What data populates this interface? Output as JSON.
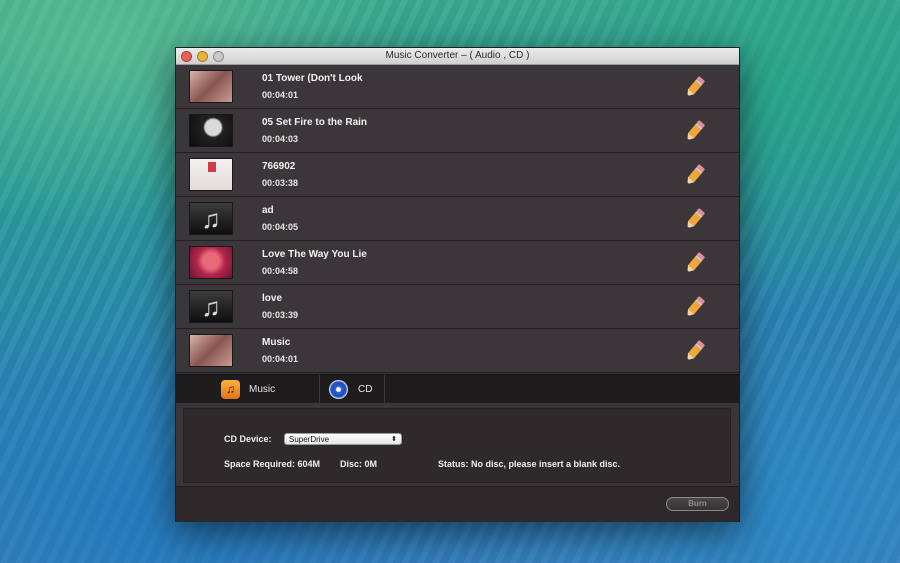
{
  "window": {
    "title": "Music Converter – ( Audio , CD )"
  },
  "tracks": [
    {
      "title": "01 Tower (Don't Look",
      "duration": "00:04:01",
      "art": "album-art"
    },
    {
      "title": "05 Set Fire to the Rain",
      "duration": "00:04:03",
      "art": "album-art"
    },
    {
      "title": "766902",
      "duration": "00:03:38",
      "art": "album-art"
    },
    {
      "title": "ad",
      "duration": "00:04:05",
      "art": "music-note-icon"
    },
    {
      "title": "Love The Way You Lie",
      "duration": "00:04:58",
      "art": "album-art"
    },
    {
      "title": "love",
      "duration": "00:03:39",
      "art": "music-note-icon"
    },
    {
      "title": "Music",
      "duration": "00:04:01",
      "art": "album-art"
    }
  ],
  "tabs": [
    {
      "label": "Music",
      "icon": "music-app-icon"
    },
    {
      "label": "CD",
      "icon": "cd-icon",
      "selected": true
    }
  ],
  "cd_panel": {
    "device_label": "CD Device:",
    "device_value": "SuperDrive",
    "space_required": "Space Required: 604M",
    "disc": "Disc: 0M",
    "status": "Status: No disc, please insert a blank disc."
  },
  "footer": {
    "burn_label": "Burn"
  },
  "colors": {
    "window_bg": "#3a3538",
    "accent_orange": "#f0a63a",
    "accent_blue": "#2a62d6"
  }
}
